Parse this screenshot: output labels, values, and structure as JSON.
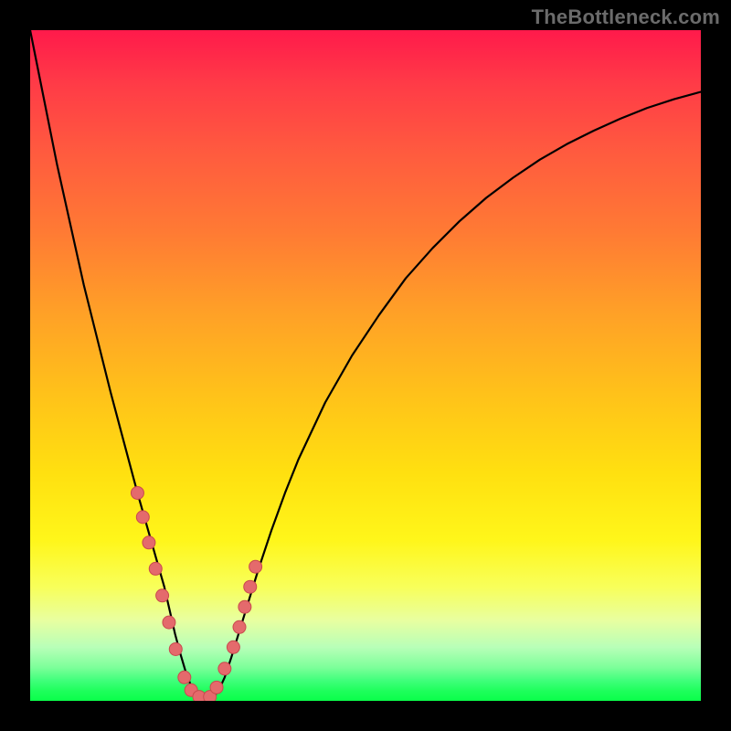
{
  "watermark": "TheBottleneck.com",
  "chart_data": {
    "type": "line",
    "title": "",
    "xlabel": "",
    "ylabel": "",
    "xlim": [
      0,
      100
    ],
    "ylim": [
      0,
      100
    ],
    "grid": false,
    "legend": false,
    "series": [
      {
        "name": "curve",
        "x": [
          0,
          2,
          4,
          6,
          8,
          10,
          12,
          14,
          16,
          18,
          19,
          20,
          20.8,
          21.6,
          22.4,
          23.2,
          24,
          25,
          26,
          27,
          28,
          29,
          30,
          32,
          34,
          36,
          38,
          40,
          44,
          48,
          52,
          56,
          60,
          64,
          68,
          72,
          76,
          80,
          84,
          88,
          92,
          96,
          100
        ],
        "y": [
          100,
          90,
          80,
          71,
          62,
          54,
          46,
          38.5,
          31,
          24,
          20.5,
          17,
          13.5,
          10,
          7,
          4.3,
          2.2,
          1.0,
          0.4,
          0.4,
          1.3,
          3.5,
          6.5,
          13,
          19.5,
          25.5,
          31,
          36,
          44.5,
          51.5,
          57.5,
          63,
          67.5,
          71.5,
          75,
          78,
          80.7,
          83,
          85,
          86.8,
          88.4,
          89.7,
          90.8
        ]
      },
      {
        "name": "dots",
        "x": [
          16.0,
          16.8,
          17.7,
          18.7,
          19.7,
          20.7,
          21.7,
          23.0,
          24.0,
          25.2,
          26.8,
          27.8,
          29.0,
          30.3,
          31.2,
          32.0,
          32.8,
          33.6
        ],
        "y": [
          31.0,
          27.4,
          23.6,
          19.7,
          15.7,
          11.7,
          7.7,
          3.5,
          1.6,
          0.6,
          0.6,
          2.0,
          4.8,
          8.0,
          11.0,
          14.0,
          17.0,
          20.0
        ]
      }
    ],
    "background_gradient": {
      "stops": [
        {
          "pos": 0.0,
          "color": "#ff1a4b"
        },
        {
          "pos": 0.3,
          "color": "#ff7a34"
        },
        {
          "pos": 0.6,
          "color": "#ffd015"
        },
        {
          "pos": 0.82,
          "color": "#fbff4a"
        },
        {
          "pos": 0.92,
          "color": "#b8ffb8"
        },
        {
          "pos": 1.0,
          "color": "#0aff4a"
        }
      ]
    },
    "dot_style": {
      "radius_px": 7,
      "fill": "#e46a6c",
      "stroke": "#c94a4e"
    }
  }
}
